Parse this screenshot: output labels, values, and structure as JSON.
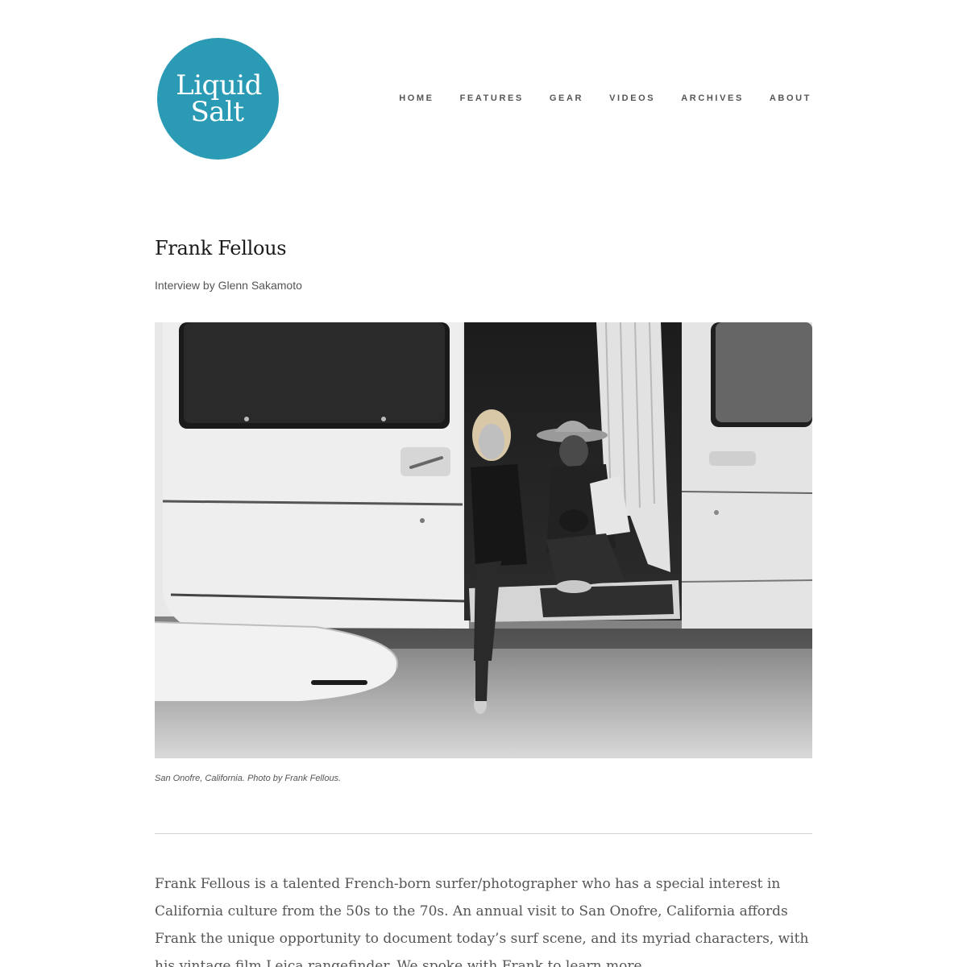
{
  "brand": {
    "logo_line1": "Liquid",
    "logo_line2": "Salt",
    "logo_color": "#2b9bb5"
  },
  "nav": {
    "items": [
      {
        "label": "HOME"
      },
      {
        "label": "FEATURES"
      },
      {
        "label": "GEAR"
      },
      {
        "label": "VIDEOS"
      },
      {
        "label": "ARCHIVES"
      },
      {
        "label": "ABOUT"
      }
    ]
  },
  "article": {
    "title": "Frank Fellous",
    "byline": "Interview by Glenn Sakamoto",
    "caption": "San Onofre, California. Photo by Frank Fellous.",
    "intro": "Frank Fellous is a talented French-born surfer/photographer who has a special interest in California culture from the 50s to the 70s. An annual visit to San Onofre, California affords Frank the unique opportunity to document today’s surf scene, and its myriad characters, with his vintage film Leica rangefinder. We spoke with Frank to learn more."
  }
}
